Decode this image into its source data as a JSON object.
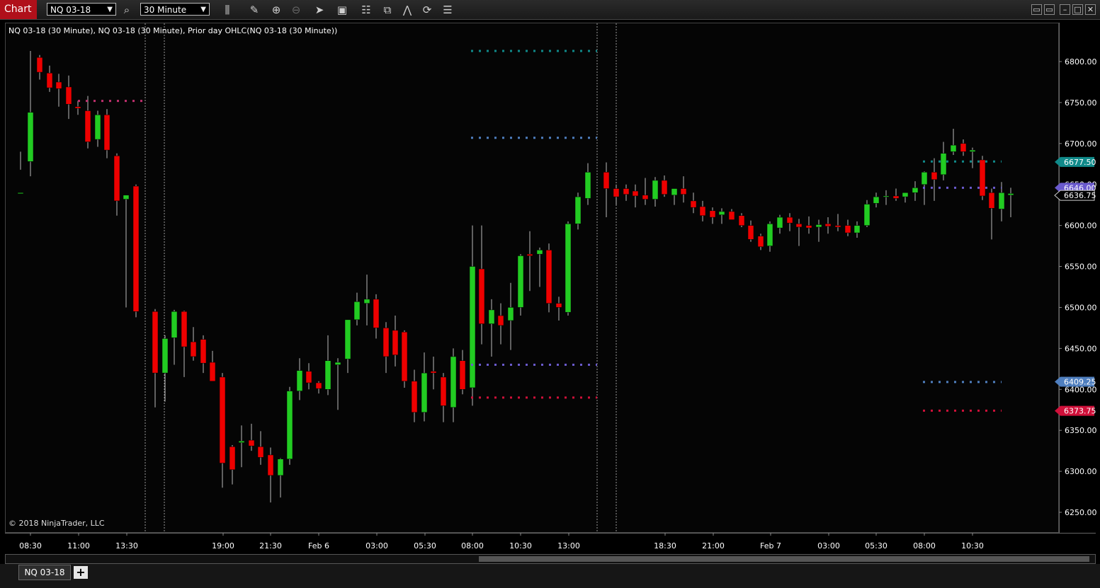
{
  "toolbar": {
    "chart_label": "Chart",
    "instrument": "NQ 03-18",
    "interval": "30 Minute",
    "icons": [
      "search-icon",
      "bar-type-icon",
      "drawing-tool-icon",
      "zoom-in-icon",
      "zoom-out-icon",
      "pointer-icon",
      "data-box-icon",
      "strategies-icon",
      "templates-icon",
      "indicators-icon",
      "properties-icon",
      "menu-icon"
    ]
  },
  "chart": {
    "title": "NQ 03-18 (30 Minute), NQ 03-18 (30 Minute), Prior day OHLC(NQ 03-18 (30 Minute))",
    "copyright": "© 2018 NinjaTrader, LLC",
    "price_labels": [
      "6800.00",
      "6750.00",
      "6700.00",
      "6650.00",
      "6600.00",
      "6550.00",
      "6500.00",
      "6450.00",
      "6400.00",
      "6350.00",
      "6300.00",
      "6250.00"
    ],
    "time_labels": [
      "08:30",
      "11:00",
      "13:30",
      "19:00",
      "21:30",
      "Feb 6",
      "03:00",
      "05:30",
      "08:00",
      "10:30",
      "13:00",
      "18:30",
      "21:00",
      "Feb 7",
      "03:00",
      "05:30",
      "08:00",
      "10:30"
    ],
    "markers": [
      {
        "value": "6677.50",
        "color": "#108a8a"
      },
      {
        "value": "6646.00",
        "color": "#6a5acd"
      },
      {
        "value": "6636.75",
        "color": "#000000"
      },
      {
        "value": "6409.25",
        "color": "#4f7fbf"
      },
      {
        "value": "6373.75",
        "color": "#d0103a"
      }
    ],
    "colors": {
      "up": "#22cc22",
      "down": "#ee0000",
      "wick": "#bbbbbb"
    }
  },
  "tabs": {
    "active": "NQ 03-18",
    "add_label": "+"
  }
}
